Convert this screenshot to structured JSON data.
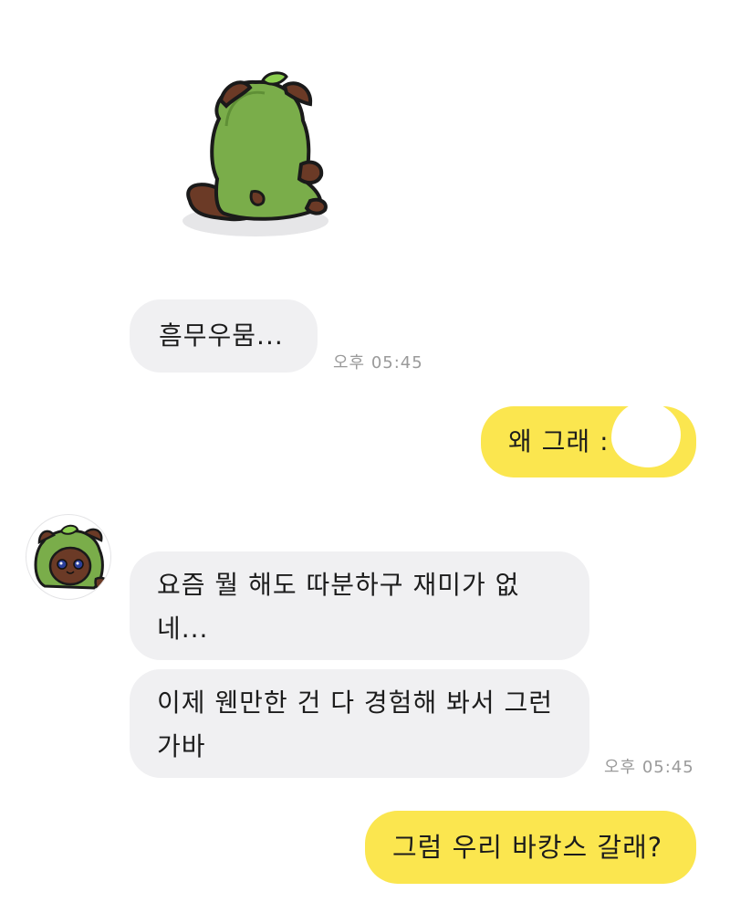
{
  "chat": {
    "messages": [
      {
        "sender": "friend",
        "type": "sticker",
        "sticker_icon": "green-cat-sticker-back-icon"
      },
      {
        "sender": "friend",
        "type": "text",
        "text": "흠무우뭄..."
      },
      {
        "sender": "friend",
        "type": "time",
        "text": "오후 05:45"
      },
      {
        "sender": "me",
        "type": "text",
        "text": "왜 그래 :"
      },
      {
        "sender": "friend",
        "type": "text",
        "text": "요즘 뭘 해도 따분하구 재미가 없네..."
      },
      {
        "sender": "friend",
        "type": "text",
        "text": "이제 웬만한 건 다 경험해 봐서 그런가바"
      },
      {
        "sender": "friend",
        "type": "time",
        "text": "오후 05:45"
      },
      {
        "sender": "me",
        "type": "text",
        "text": "그럼 우리 바캉스 갈래?"
      }
    ]
  },
  "colors": {
    "incoming_bubble": "#f0f0f2",
    "outgoing_bubble": "#fbe64f",
    "timestamp": "#9a9a9a",
    "sticker_green": "#7aad4a",
    "sticker_brown": "#6b3a26"
  },
  "friend": {
    "avatar_icon": "green-cat-avatar-icon"
  }
}
